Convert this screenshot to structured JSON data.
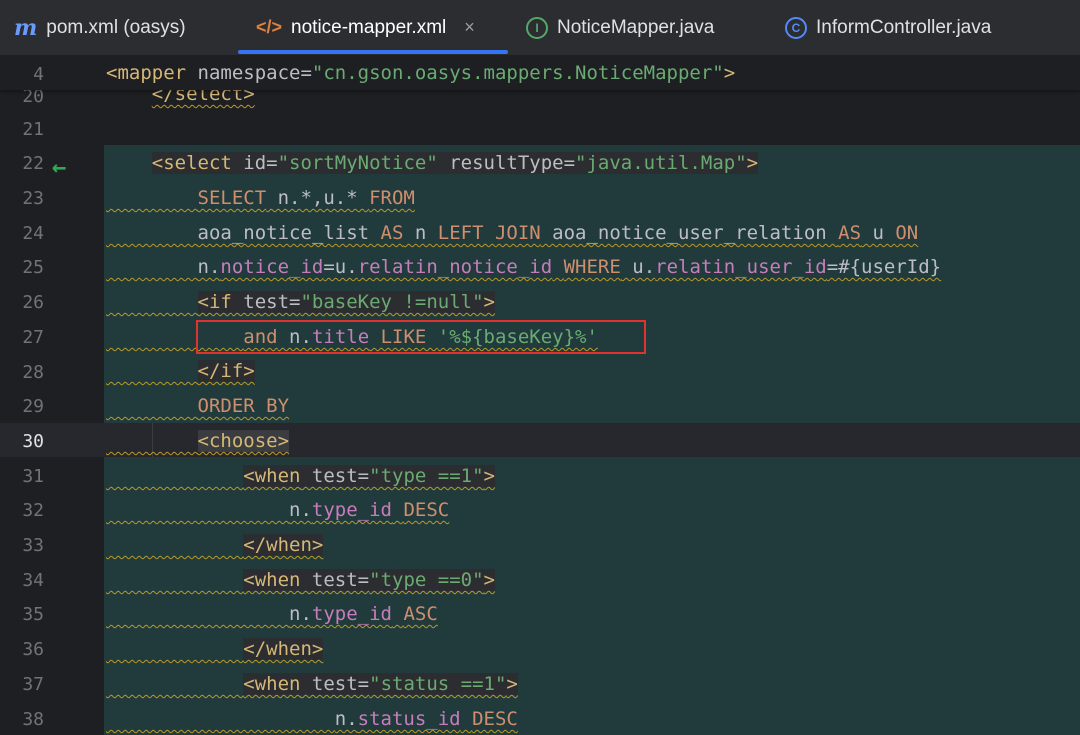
{
  "tabs": [
    {
      "icon": "m",
      "label": "pom.xml (oasys)",
      "active": false
    },
    {
      "icon": "</>",
      "label": "notice-mapper.xml",
      "active": true,
      "close": "×"
    },
    {
      "icon": "I",
      "label": "NoticeMapper.java",
      "active": false
    },
    {
      "icon": "C",
      "label": "InformController.java",
      "active": false
    }
  ],
  "sticky": {
    "line": "4",
    "open": "<mapper",
    "attr": " namespace=",
    "value": "\"cn.gson.oasys.mappers.NoticeMapper\"",
    "close": ">"
  },
  "lines": {
    "l20": "20",
    "l21": "21",
    "l22": "22",
    "l23": "23",
    "l24": "24",
    "l25": "25",
    "l26": "26",
    "l27": "27",
    "l28": "28",
    "l29": "29",
    "l30": "30",
    "l31": "31",
    "l32": "32",
    "l33": "33",
    "l34": "34",
    "l35": "35",
    "l36": "36",
    "l37": "37",
    "l38": "38"
  },
  "code": {
    "l20": "</select>",
    "l22_open": "<select",
    "l22_id_attr": " id=",
    "l22_id_val": "\"sortMyNotice\"",
    "l22_rt_attr": " resultType=",
    "l22_rt_val": "\"java.util.Map\"",
    "l22_close": ">",
    "l23_select": "SELECT",
    "l23_mid": " n.*,u.* ",
    "l23_from": "FROM",
    "l24_a": "aoa_notice_list ",
    "l24_as1": "AS",
    "l24_b": " n ",
    "l24_lj": "LEFT JOIN",
    "l24_c": " aoa_notice_user_relation ",
    "l24_as2": "AS",
    "l24_d": " u ",
    "l24_on": "ON",
    "l25_a": "n.",
    "l25_f1": "notice_id",
    "l25_b": "=u.",
    "l25_f2": "relatin_notice_id",
    "l25_c": " ",
    "l25_where": "WHERE",
    "l25_d": " u.",
    "l25_f3": "relatin_user_id",
    "l25_e": "=#{userId}",
    "l26_open": "<if",
    "l26_attr": " test=",
    "l26_val": "\"baseKey !=null\"",
    "l26_close": ">",
    "l27_and": "and",
    "l27_a": " n.",
    "l27_f": "title",
    "l27_like": " LIKE ",
    "l27_str": "'%${baseKey}%'",
    "l28": "</if>",
    "l29_order": "ORDER BY",
    "l30": "<choose>",
    "l31_open": "<when",
    "l31_attr": " test=",
    "l31_val": "\"type ==1\"",
    "l31_close": ">",
    "l32_a": "n.",
    "l32_f": "type_id",
    "l32_b": " ",
    "l32_desc": "DESC",
    "l33": "</when>",
    "l34_open": "<when",
    "l34_attr": " test=",
    "l34_val": "\"type ==0\"",
    "l34_close": ">",
    "l35_a": "n.",
    "l35_f": "type_id",
    "l35_b": " ",
    "l35_asc": "ASC",
    "l36": "</when>",
    "l37_open": "<when",
    "l37_attr": " test=",
    "l37_val": "\"status ==1\"",
    "l37_close": ">",
    "l38_a": "n.",
    "l38_f": "status_id",
    "l38_b": " ",
    "l38_desc": "DESC"
  },
  "colors": {
    "tag": "#d5b778",
    "string": "#6aab73",
    "keyword": "#cf8e6d",
    "field": "#c77dbb",
    "selection": "#213b3c",
    "highlight_box": "#e0332f",
    "arrow": "#2fa84f"
  }
}
